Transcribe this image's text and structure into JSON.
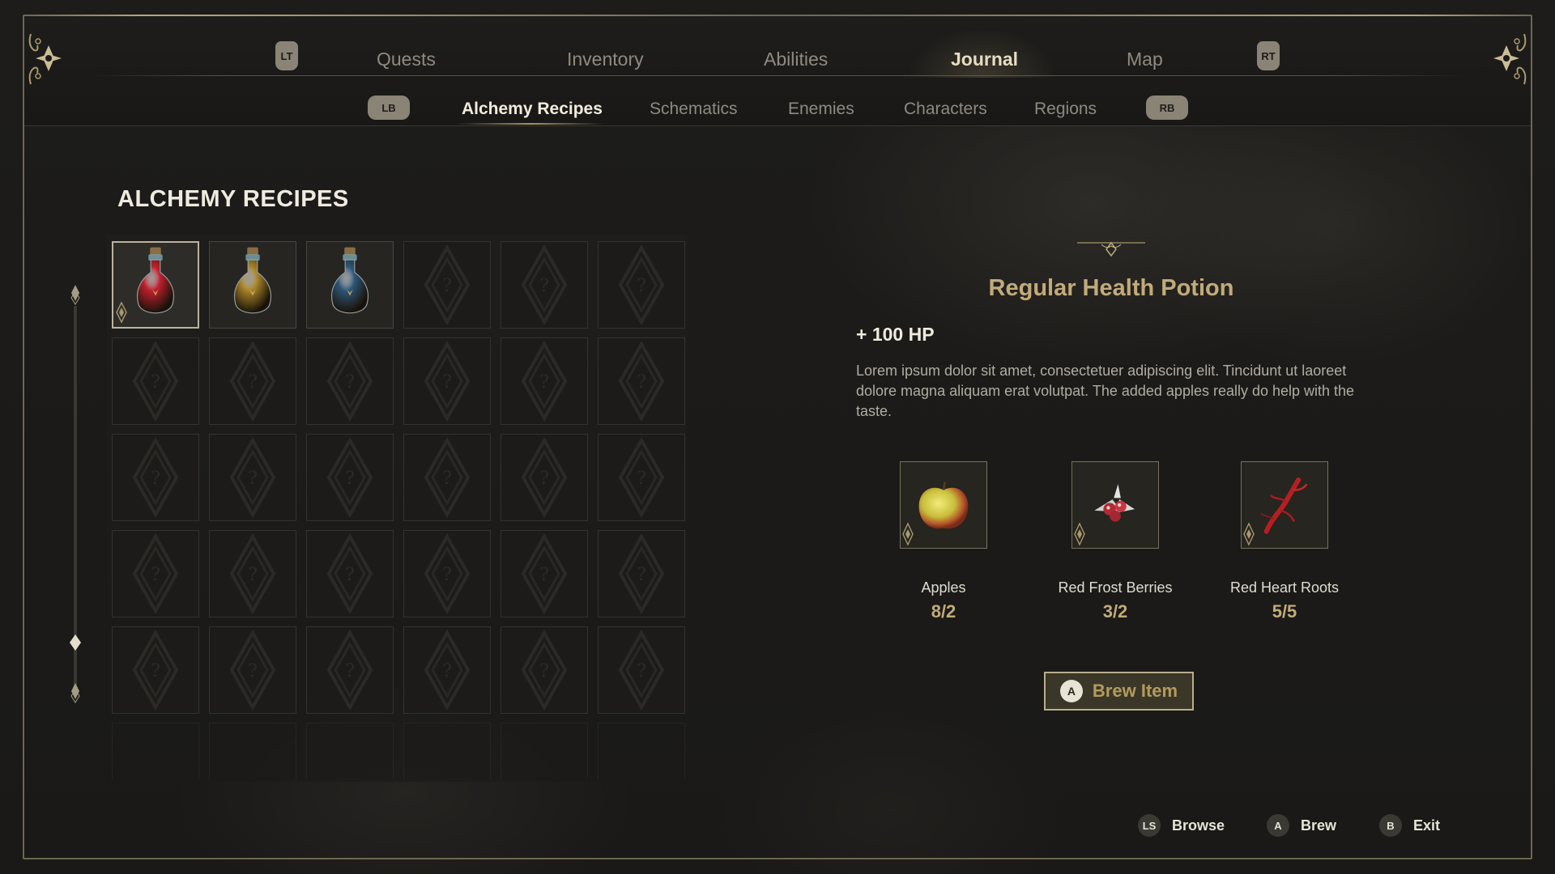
{
  "top_nav": {
    "left_trigger": "LT",
    "right_trigger": "RT",
    "tabs": [
      {
        "label": "Quests"
      },
      {
        "label": "Inventory"
      },
      {
        "label": "Abilities"
      },
      {
        "label": "Journal"
      },
      {
        "label": "Map"
      }
    ],
    "active_tab": "Journal"
  },
  "sub_nav": {
    "left_bumper": "LB",
    "right_bumper": "RB",
    "tabs": [
      {
        "label": "Alchemy Recipes"
      },
      {
        "label": "Schematics"
      },
      {
        "label": "Enemies"
      },
      {
        "label": "Characters"
      },
      {
        "label": "Regions"
      }
    ],
    "active_tab": "Alchemy Recipes"
  },
  "recipes": {
    "title": "ALCHEMY RECIPES",
    "grid_columns": 6,
    "unlocked": [
      {
        "icon": "red-potion-icon",
        "color": "#c8202e",
        "selected": true
      },
      {
        "icon": "yellow-potion-icon",
        "color": "#b08a2a",
        "selected": false
      },
      {
        "icon": "blue-potion-icon",
        "color": "#2f5a7e",
        "selected": false
      }
    ],
    "locked_icon": "locked-recipe-icon",
    "total_full_slots": 30,
    "partial_row_slots": 6
  },
  "detail": {
    "name": "Regular Health Potion",
    "stat": "+ 100 HP",
    "description": "Lorem ipsum dolor sit amet, consectetuer adipiscing elit.  Tincidunt ut laoreet dolore magna aliquam erat volutpat. The added apples really do help with the taste.",
    "ingredients": [
      {
        "name": "Apples",
        "count": "8/2",
        "icon": "apple-icon"
      },
      {
        "name": "Red Frost Berries",
        "count": "3/2",
        "icon": "red-frost-berries-icon"
      },
      {
        "name": "Red Heart Roots",
        "count": "5/5",
        "icon": "red-heart-roots-icon"
      }
    ],
    "brew_button": {
      "button": "A",
      "label": "Brew Item"
    }
  },
  "footer_hints": [
    {
      "button": "LS",
      "label": "Browse"
    },
    {
      "button": "A",
      "label": "Brew"
    },
    {
      "button": "B",
      "label": "Exit"
    }
  ],
  "colors": {
    "accent_gold": "#c2ab7a",
    "frame": "#6e6650",
    "background": "#1b1a18"
  }
}
